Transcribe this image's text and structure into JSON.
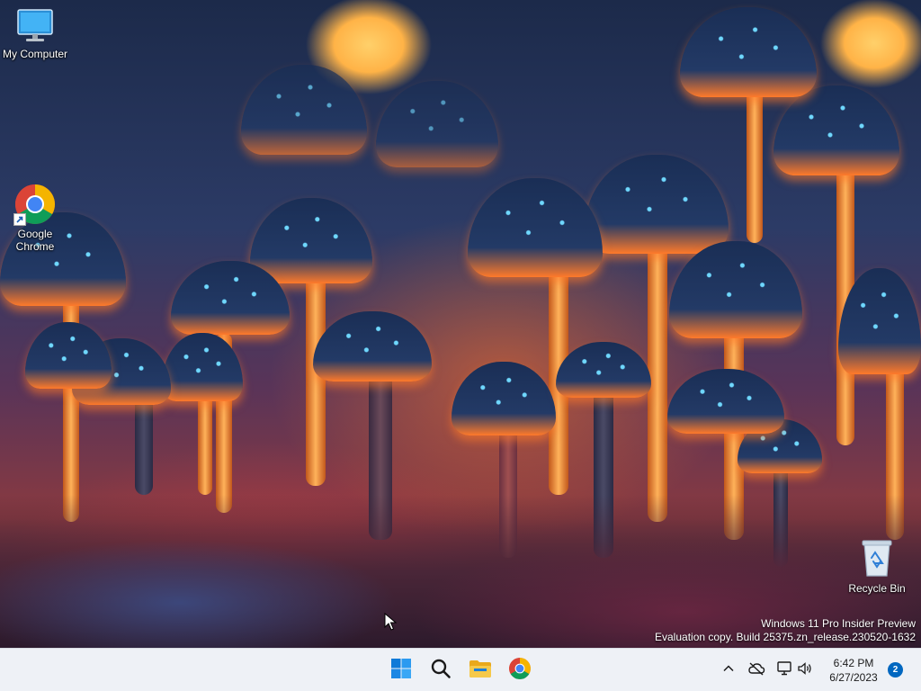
{
  "desktop": {
    "icons": [
      {
        "label": "My Computer",
        "icon": "monitor-icon"
      },
      {
        "label": "Google Chrome",
        "icon": "chrome-icon"
      },
      {
        "label": "Recycle Bin",
        "icon": "recycle-bin-icon"
      }
    ],
    "watermark": {
      "line1": "Windows 11 Pro Insider Preview",
      "line2": "Evaluation copy. Build 25375.zn_release.230520-1632"
    }
  },
  "taskbar": {
    "pinned": [
      {
        "name": "start",
        "icon": "windows-start-icon"
      },
      {
        "name": "search",
        "icon": "search-icon"
      },
      {
        "name": "file-explorer",
        "icon": "folder-icon"
      },
      {
        "name": "chrome",
        "icon": "chrome-icon"
      }
    ],
    "tray": {
      "icons": [
        "chevron-up-icon",
        "cloud-offline-icon",
        "network-icon",
        "speaker-icon"
      ],
      "time": "6:42 PM",
      "date": "6/27/2023",
      "notifications": "2"
    }
  },
  "colors": {
    "taskbar_bg": "#eef1f6",
    "accent": "#0067c0",
    "folder_yellow": "#f2b92c"
  }
}
